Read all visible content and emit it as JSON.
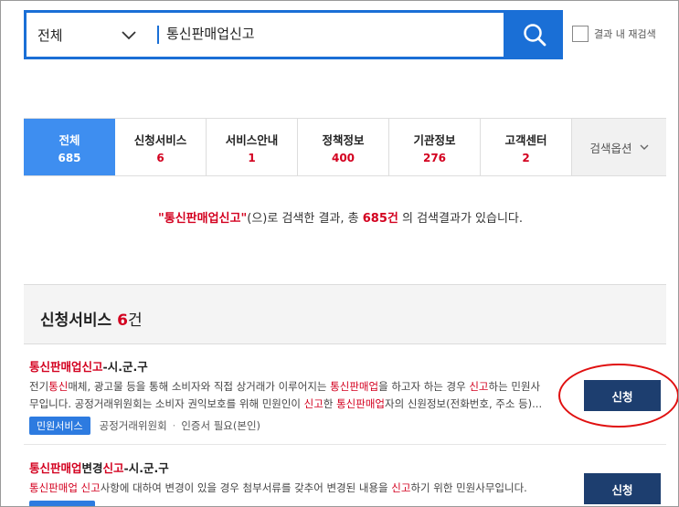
{
  "search": {
    "scope": "전체",
    "query": "통신판매업신고",
    "re_search_label": "결과 내 재검색"
  },
  "tabs": [
    {
      "label": "전체",
      "count": "685"
    },
    {
      "label": "신청서비스",
      "count": "6"
    },
    {
      "label": "서비스안내",
      "count": "1"
    },
    {
      "label": "정책정보",
      "count": "400"
    },
    {
      "label": "기관정보",
      "count": "276"
    },
    {
      "label": "고객센터",
      "count": "2"
    }
  ],
  "options_label": "검색옵션",
  "summary": {
    "keyword": "\"통신판매업신고\"",
    "mid": "(으)로 검색한 결과, 총 ",
    "total": "685건",
    "tail": " 의 검색결과가 있습니다."
  },
  "section": {
    "title": "신청서비스",
    "count": "6",
    "unit": "건"
  },
  "results": [
    {
      "title_hl": "통신판매업신고",
      "title_rest": "-시.군.구",
      "line1": [
        "전기",
        "통신",
        "매체, 광고물 등을 통해 소비자와 직접 상거래가 이루어지는 ",
        "통신판매업",
        "을 하고자 하는 경우 ",
        "신고",
        "하는 민원사"
      ],
      "line2": [
        "무입니다. 공정거래위원회는 소비자 권익보호를 위해 민원인이 ",
        "신고",
        "한 ",
        "통신판매업",
        "자의 신원정보(전화번호, 주소 등)..."
      ],
      "badge": "민원서비스",
      "agency": "공정거래위원회",
      "auth": "인증서 필요(본인)",
      "button": "신청"
    },
    {
      "title_hl1": "통신판매업",
      "title_mid": "변경",
      "title_hl2": "신고",
      "title_rest": "-시.군.구",
      "line1": [
        "통신판매업 신고",
        "사항에 대하여 변경이 있을 경우 첨부서류를 갖추어 변경된 내용을 ",
        "신고",
        "하기 위한 민원사무입니다."
      ],
      "button": "신청"
    }
  ],
  "colors": {
    "primary": "#1a6fd6",
    "active_tab": "#3e8ef0",
    "highlight": "#d3001f",
    "apply_button": "#1d3e6f",
    "annotation": "#e01010"
  }
}
